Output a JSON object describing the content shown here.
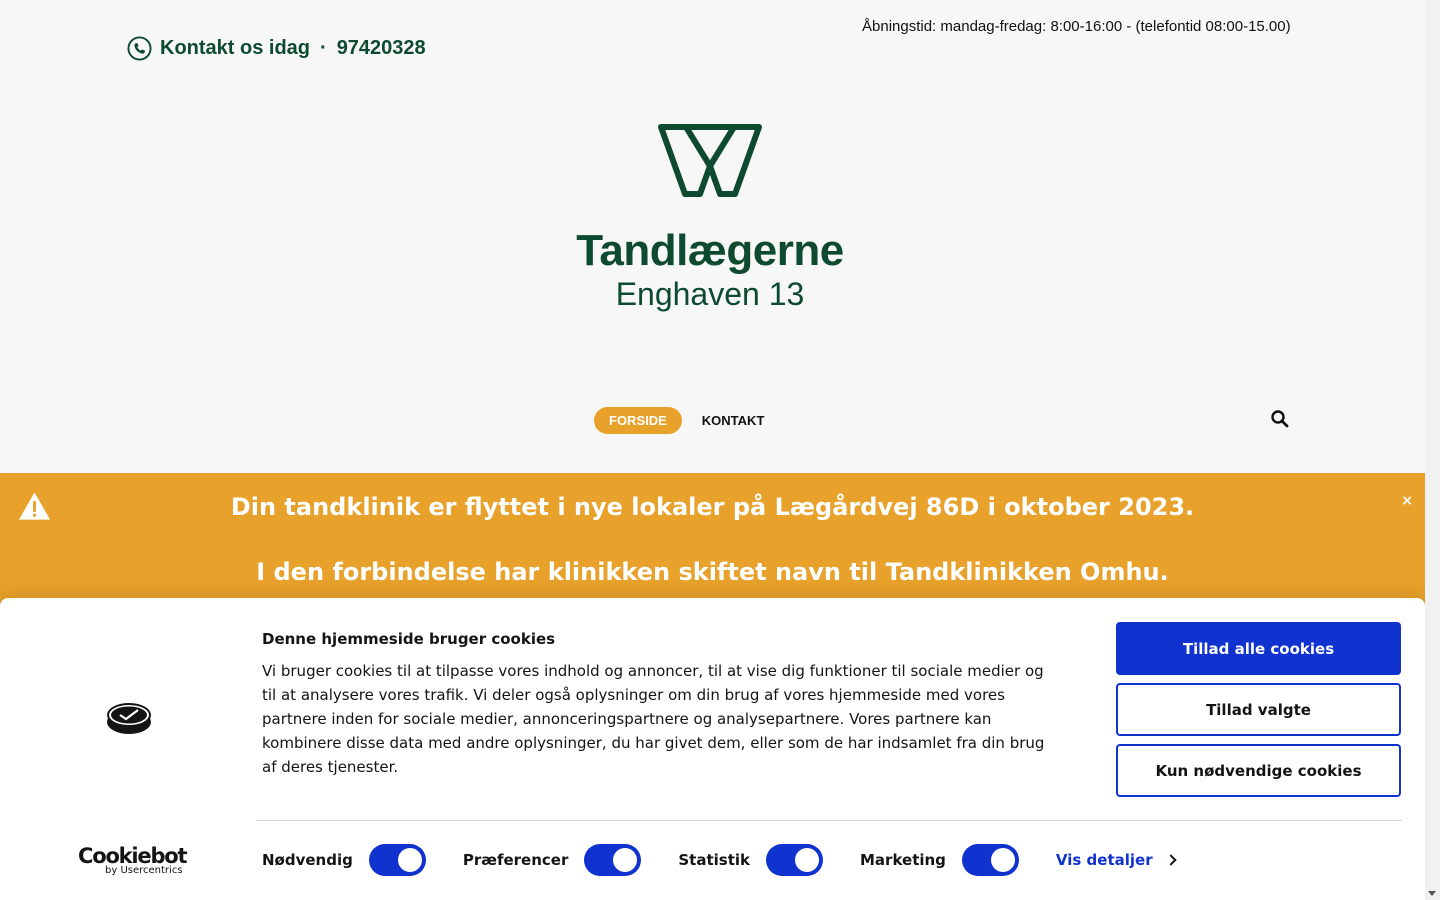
{
  "header": {
    "contact_label": "Kontakt os idag",
    "separator": "·",
    "phone": "97420328",
    "hours": "Åbningstid: mandag-fredag: 8:00-16:00 - (telefontid 08:00-15.00)"
  },
  "logo": {
    "name": "Tandlægerne",
    "subtitle": "Enghaven 13"
  },
  "nav": {
    "items": [
      {
        "label": "FORSIDE",
        "active": true
      },
      {
        "label": "KONTAKT",
        "active": false
      }
    ]
  },
  "banner": {
    "line1": "Din tandklinik er flyttet i nye lokaler på Lægårdvej 86D i oktober 2023.",
    "line2": "I den forbindelse har klinikken skiftet navn til Tandklinikken Omhu.",
    "close": "×"
  },
  "cookie": {
    "brand": "Cookiebot",
    "brand_by": "by Usercentrics",
    "title": "Denne hjemmeside bruger cookies",
    "description": "Vi bruger cookies til at tilpasse vores indhold og annoncer, til at vise dig funktioner til sociale medier og til at analysere vores trafik. Vi deler også oplysninger om din brug af vores hjemmeside med vores partnere inden for sociale medier, annonceringspartnere og analysepartnere. Vores partnere kan kombinere disse data med andre oplysninger, du har givet dem, eller som de har indsamlet fra din brug af deres tjenester.",
    "buttons": {
      "allow_all": "Tillad alle cookies",
      "allow_selected": "Tillad valgte",
      "necessary_only": "Kun nødvendige cookies"
    },
    "toggles": [
      {
        "label": "Nødvendig",
        "on": true
      },
      {
        "label": "Præferencer",
        "on": true
      },
      {
        "label": "Statistik",
        "on": true
      },
      {
        "label": "Marketing",
        "on": true
      }
    ],
    "details_link": "Vis detaljer"
  },
  "colors": {
    "brand_green": "#0d4a2f",
    "accent_orange": "#e8a12a",
    "cookie_blue": "#1032cf"
  }
}
